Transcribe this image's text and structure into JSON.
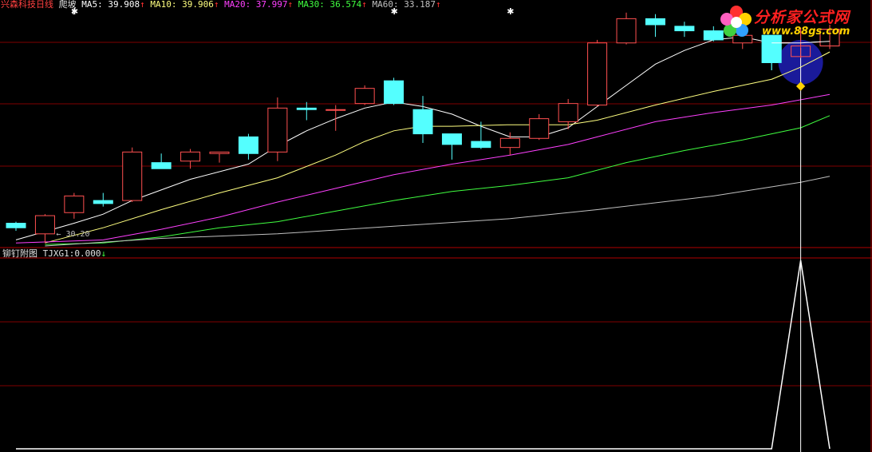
{
  "header": {
    "stock_name": "兴森科技",
    "period": "日线",
    "formula": "爬坡",
    "ma": [
      {
        "label": "MA5:",
        "value": "39.908",
        "arrow": "↑",
        "color": "#ffffff"
      },
      {
        "label": "MA10:",
        "value": "39.906",
        "arrow": "↑",
        "color": "#ffff80"
      },
      {
        "label": "MA20:",
        "value": "37.997",
        "arrow": "↑",
        "color": "#ff40ff"
      },
      {
        "label": "MA30:",
        "value": "36.574",
        "arrow": "↑",
        "color": "#40ff40"
      },
      {
        "label": "MA60:",
        "value": "33.187",
        "arrow": "↑",
        "color": "#c0c0c0"
      }
    ],
    "arrow_color": "#ff3030"
  },
  "sub_header": {
    "title": "铆钉附图",
    "indicator_label": "TJXG1:",
    "indicator_value": "0.000",
    "indicator_arrow": "↓"
  },
  "logo": {
    "text": "分析家公式网",
    "url": "www.88gs.com"
  },
  "colors": {
    "up": "#ff5050",
    "down": "#54ffff",
    "grid": "#800000",
    "separator": "#b00000",
    "cursor": "#ffffff",
    "ma5": "#ffffff",
    "ma10": "#ffff80",
    "ma20": "#ff40ff",
    "ma30": "#40ff40",
    "ma60": "#c0c0c0",
    "signal": "#ffffff",
    "marker": "#ffd200",
    "circle": "#1a1a9a"
  },
  "chart_data": {
    "type": "candlestick",
    "price_range": [
      30.0,
      45.6
    ],
    "low_marker": {
      "label": "← 30.20",
      "value": 30.2,
      "index": 1
    },
    "candles": [
      {
        "o": 31.5,
        "h": 31.6,
        "l": 31.0,
        "c": 31.2
      },
      {
        "o": 30.8,
        "h": 32.1,
        "l": 30.2,
        "c": 32.0
      },
      {
        "o": 32.2,
        "h": 33.5,
        "l": 31.8,
        "c": 33.3
      },
      {
        "o": 33.0,
        "h": 33.5,
        "l": 32.6,
        "c": 32.8
      },
      {
        "o": 33.0,
        "h": 36.5,
        "l": 32.9,
        "c": 36.2
      },
      {
        "o": 35.5,
        "h": 36.1,
        "l": 35.1,
        "c": 35.1
      },
      {
        "o": 35.6,
        "h": 36.4,
        "l": 35.1,
        "c": 36.2
      },
      {
        "o": 36.1,
        "h": 36.2,
        "l": 35.5,
        "c": 36.2
      },
      {
        "o": 37.2,
        "h": 37.4,
        "l": 35.7,
        "c": 36.1
      },
      {
        "o": 36.2,
        "h": 39.8,
        "l": 35.6,
        "c": 39.1
      },
      {
        "o": 39.1,
        "h": 39.5,
        "l": 38.3,
        "c": 39.0
      },
      {
        "o": 39.0,
        "h": 39.3,
        "l": 37.6,
        "c": 39.0
      },
      {
        "o": 39.4,
        "h": 40.6,
        "l": 39.3,
        "c": 40.4
      },
      {
        "o": 40.9,
        "h": 41.1,
        "l": 39.3,
        "c": 39.4
      },
      {
        "o": 39.0,
        "h": 39.9,
        "l": 36.8,
        "c": 37.4
      },
      {
        "o": 37.4,
        "h": 37.4,
        "l": 35.7,
        "c": 36.7
      },
      {
        "o": 36.9,
        "h": 38.2,
        "l": 36.4,
        "c": 36.5
      },
      {
        "o": 36.5,
        "h": 37.5,
        "l": 36.0,
        "c": 37.1
      },
      {
        "o": 37.1,
        "h": 38.7,
        "l": 37.0,
        "c": 38.4
      },
      {
        "o": 38.2,
        "h": 39.7,
        "l": 37.7,
        "c": 39.4
      },
      {
        "o": 39.3,
        "h": 43.6,
        "l": 39.2,
        "c": 43.4
      },
      {
        "o": 43.4,
        "h": 45.4,
        "l": 43.3,
        "c": 45.0
      },
      {
        "o": 45.0,
        "h": 45.3,
        "l": 43.8,
        "c": 44.6
      },
      {
        "o": 44.5,
        "h": 44.8,
        "l": 43.8,
        "c": 44.2
      },
      {
        "o": 44.2,
        "h": 44.5,
        "l": 43.5,
        "c": 43.6
      },
      {
        "o": 43.4,
        "h": 44.6,
        "l": 43.0,
        "c": 43.9
      },
      {
        "o": 43.9,
        "h": 43.9,
        "l": 41.6,
        "c": 42.1
      },
      {
        "o": 42.5,
        "h": 44.4,
        "l": 42.4,
        "c": 43.2
      },
      {
        "o": 43.2,
        "h": 44.6,
        "l": 43.0,
        "c": 44.3
      }
    ],
    "ma_series": [
      {
        "name": "MA5",
        "color": "#ffffff",
        "points": [
          [
            0,
            30.4
          ],
          [
            2,
            31.5
          ],
          [
            3,
            32.1
          ],
          [
            4,
            33.0
          ],
          [
            6,
            34.4
          ],
          [
            8,
            35.4
          ],
          [
            9,
            36.6
          ],
          [
            10,
            37.6
          ],
          [
            11,
            38.4
          ],
          [
            12,
            39.1
          ],
          [
            13,
            39.5
          ],
          [
            14,
            39.2
          ],
          [
            15,
            38.7
          ],
          [
            16,
            37.9
          ],
          [
            17,
            37.2
          ],
          [
            18,
            37.2
          ],
          [
            19,
            37.8
          ],
          [
            20,
            39.2
          ],
          [
            21,
            40.6
          ],
          [
            22,
            42.0
          ],
          [
            23,
            42.9
          ],
          [
            24,
            43.6
          ],
          [
            25,
            43.8
          ],
          [
            26,
            43.4
          ],
          [
            27,
            43.4
          ],
          [
            28,
            43.5
          ]
        ]
      },
      {
        "name": "MA10",
        "color": "#ffff80",
        "points": [
          [
            1,
            30.2
          ],
          [
            3,
            31.2
          ],
          [
            5,
            32.4
          ],
          [
            7,
            33.5
          ],
          [
            9,
            34.5
          ],
          [
            11,
            36.0
          ],
          [
            12,
            36.9
          ],
          [
            13,
            37.6
          ],
          [
            14,
            37.9
          ],
          [
            15,
            37.9
          ],
          [
            17,
            38.0
          ],
          [
            19,
            38.0
          ],
          [
            20,
            38.3
          ],
          [
            22,
            39.3
          ],
          [
            24,
            40.2
          ],
          [
            26,
            41.0
          ],
          [
            27,
            41.8
          ],
          [
            28,
            42.8
          ]
        ]
      },
      {
        "name": "MA20",
        "color": "#ff40ff",
        "points": [
          [
            0,
            30.2
          ],
          [
            3,
            30.4
          ],
          [
            5,
            31.1
          ],
          [
            7,
            31.9
          ],
          [
            9,
            32.9
          ],
          [
            11,
            33.8
          ],
          [
            13,
            34.7
          ],
          [
            15,
            35.4
          ],
          [
            17,
            36.0
          ],
          [
            19,
            36.7
          ],
          [
            20,
            37.2
          ],
          [
            22,
            38.2
          ],
          [
            24,
            38.8
          ],
          [
            26,
            39.3
          ],
          [
            28,
            40.0
          ]
        ]
      },
      {
        "name": "MA30",
        "color": "#40ff40",
        "points": [
          [
            1,
            30.1
          ],
          [
            3,
            30.2
          ],
          [
            5,
            30.6
          ],
          [
            7,
            31.2
          ],
          [
            9,
            31.6
          ],
          [
            11,
            32.3
          ],
          [
            13,
            33.0
          ],
          [
            15,
            33.6
          ],
          [
            17,
            34.0
          ],
          [
            19,
            34.5
          ],
          [
            21,
            35.5
          ],
          [
            23,
            36.3
          ],
          [
            25,
            37.0
          ],
          [
            27,
            37.8
          ],
          [
            28,
            38.6
          ]
        ]
      },
      {
        "name": "MA60",
        "color": "#c0c0c0",
        "points": [
          [
            1,
            30.0
          ],
          [
            5,
            30.5
          ],
          [
            9,
            30.8
          ],
          [
            13,
            31.3
          ],
          [
            17,
            31.8
          ],
          [
            20,
            32.4
          ],
          [
            24,
            33.3
          ],
          [
            27,
            34.2
          ],
          [
            28,
            34.6
          ]
        ]
      }
    ],
    "cursor_index": 27,
    "signal_series": {
      "name": "TJXG1",
      "values_by_index": [
        [
          26,
          0
        ],
        [
          27,
          1
        ],
        [
          28,
          0
        ]
      ]
    },
    "star_marks": [
      2,
      13,
      17
    ]
  }
}
